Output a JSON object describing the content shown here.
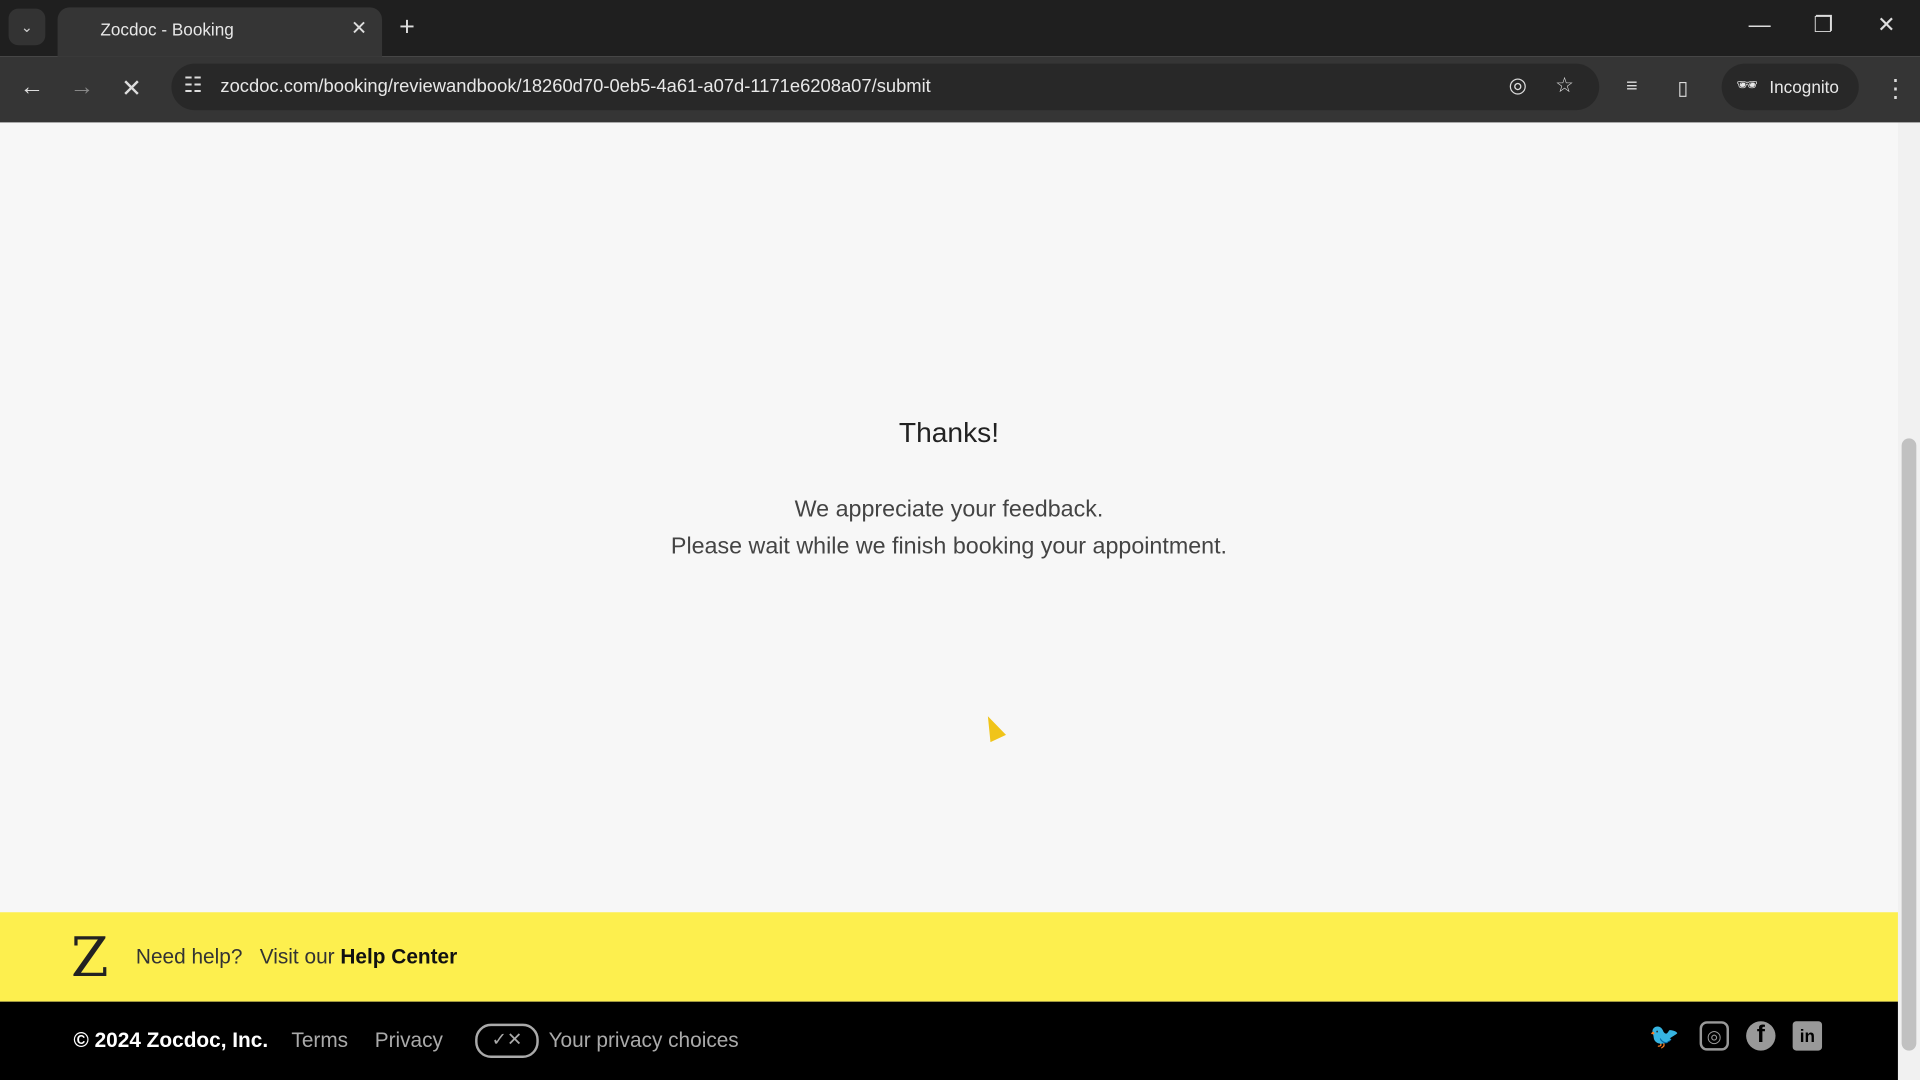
{
  "browser": {
    "tab_title": "Zocdoc - Booking",
    "url": "zocdoc.com/booking/reviewandbook/18260d70-0eb5-4a61-a07d-1171e6208a07/submit",
    "incognito_label": "Incognito"
  },
  "main": {
    "title": "Thanks!",
    "line1": "We appreciate your feedback.",
    "line2": "Please wait while we finish booking your appointment."
  },
  "help": {
    "prefix": "Need help?",
    "visit": "Visit our",
    "link": "Help Center"
  },
  "footer": {
    "copyright": "© 2024 Zocdoc, Inc.",
    "terms": "Terms",
    "privacy": "Privacy",
    "privacy_choices": "Your privacy choices",
    "social": [
      "twitter-icon",
      "instagram-icon",
      "facebook-icon",
      "linkedin-icon"
    ]
  },
  "colors": {
    "help_band": "#fdef4e",
    "footer": "#000000"
  }
}
